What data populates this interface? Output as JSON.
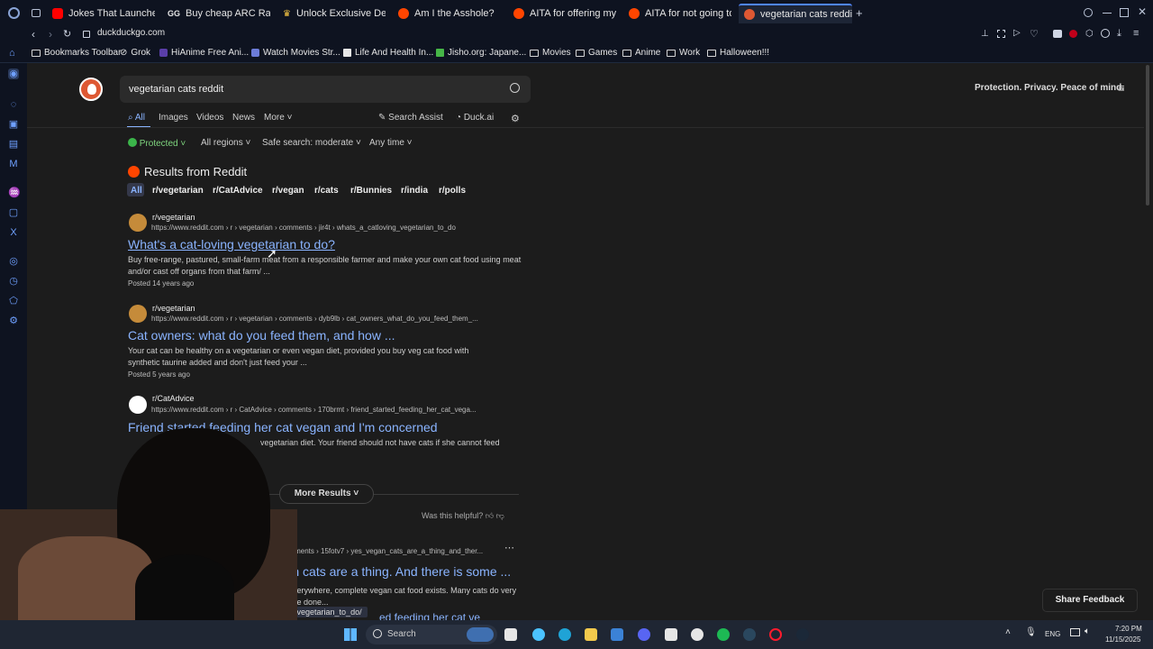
{
  "tabs": [
    {
      "label": "Jokes That Launched Ca",
      "icon": "youtube-icon",
      "color": "#ff0000"
    },
    {
      "label": "Buy cheap ARC Raiders S",
      "icon": "gg-icon",
      "color": "#ffffff"
    },
    {
      "label": "Unlock Exclusive Deals &",
      "icon": "crown-icon",
      "color": "#f5c542"
    },
    {
      "label": "Am I the Asshole?",
      "icon": "reddit-icon",
      "color": "#ff4500"
    },
    {
      "label": "AITA for offering my cou",
      "icon": "reddit-icon",
      "color": "#ff4500"
    },
    {
      "label": "AITA for not going to my",
      "icon": "reddit-icon",
      "color": "#ff4500"
    },
    {
      "label": "vegetarian cats reddit at",
      "icon": "duckduckgo-icon",
      "color": "#de5833"
    }
  ],
  "address": {
    "url": "duckduckgo.com"
  },
  "bookmarks": [
    {
      "label": "Bookmarks Toolbar",
      "icon": "folder-icon"
    },
    {
      "label": "Grok",
      "icon": "grok-icon"
    },
    {
      "label": "HiAnime Free Ani...",
      "icon": "hianime-icon"
    },
    {
      "label": "Watch Movies Str...",
      "icon": "play-icon"
    },
    {
      "label": "Life And Health In...",
      "icon": "page-icon"
    },
    {
      "label": "Jisho.org: Japane...",
      "icon": "jisho-icon"
    },
    {
      "label": "Movies",
      "icon": "folder-icon"
    },
    {
      "label": "Games",
      "icon": "folder-icon"
    },
    {
      "label": "Anime",
      "icon": "folder-icon"
    },
    {
      "label": "Work",
      "icon": "folder-icon"
    },
    {
      "label": "Halloween!!!",
      "icon": "folder-icon"
    }
  ],
  "search": {
    "query": "vegetarian cats reddit",
    "tagline": "Protection. Privacy. Peace of mind."
  },
  "nav": {
    "all": "All",
    "images": "Images",
    "videos": "Videos",
    "news": "News",
    "more": "More",
    "assist": "Search Assist",
    "duckai": "Duck.ai"
  },
  "filters": {
    "protected": "Protected",
    "regions": "All regions",
    "safe": "Safe search: moderate",
    "time": "Any time"
  },
  "reddit": {
    "heading": "Results from Reddit",
    "subtabs": [
      "All",
      "r/vegetarian",
      "r/CatAdvice",
      "r/vegan",
      "r/cats",
      "r/Bunnies",
      "r/india",
      "r/polls"
    ],
    "results": [
      {
        "sub": "r/vegetarian",
        "url": "https://www.reddit.com › r › vegetarian › comments › jir4t › whats_a_catloving_vegetarian_to_do",
        "title": "What's a cat-loving vegetarian to do?",
        "snippet": "Buy free-range, pastured, small-farm meat from a responsible farmer and make your own cat food using meat and/or cast off organs from that farm/ ...",
        "posted": "Posted 14 years ago"
      },
      {
        "sub": "r/vegetarian",
        "url": "https://www.reddit.com › r › vegetarian › comments › dyb9lb › cat_owners_what_do_you_feed_them_...",
        "title": "Cat owners: what do you feed them, and how ...",
        "snippet": "Your cat can be healthy on a vegetarian or even vegan diet, provided you buy veg cat food with synthetic taurine added and don't just feed your ...",
        "posted": "Posted 5 years ago"
      },
      {
        "sub": "r/CatAdvice",
        "url": "https://www.reddit.com › r › CatAdvice › comments › 170brmt › friend_started_feeding_her_cat_vega...",
        "title": "Friend started feeding her cat vegan and I'm concerned",
        "snippet": "vegetarian diet. Your friend should not have cats if she cannot feed",
        "posted": ""
      }
    ],
    "more_results": "More Results",
    "helpful": "Was this helpful?"
  },
  "organic": {
    "url": "comments › 15fotv7 › yes_vegan_cats_are_a_thing_and_ther...",
    "title": "egan cats are a thing. And there is some ...",
    "snippet": "everywhere, complete vegan cat food exists. Many cats do very",
    "snippet2": "nce done...",
    "next_title": "ed feeding her cat ve"
  },
  "status_url": "loving_vegetarian_to_do/",
  "share_feedback": "Share Feedback",
  "taskbar": {
    "search": "Search",
    "lang": "ENG",
    "time": "7:20 PM",
    "date": "11/15/2025"
  }
}
